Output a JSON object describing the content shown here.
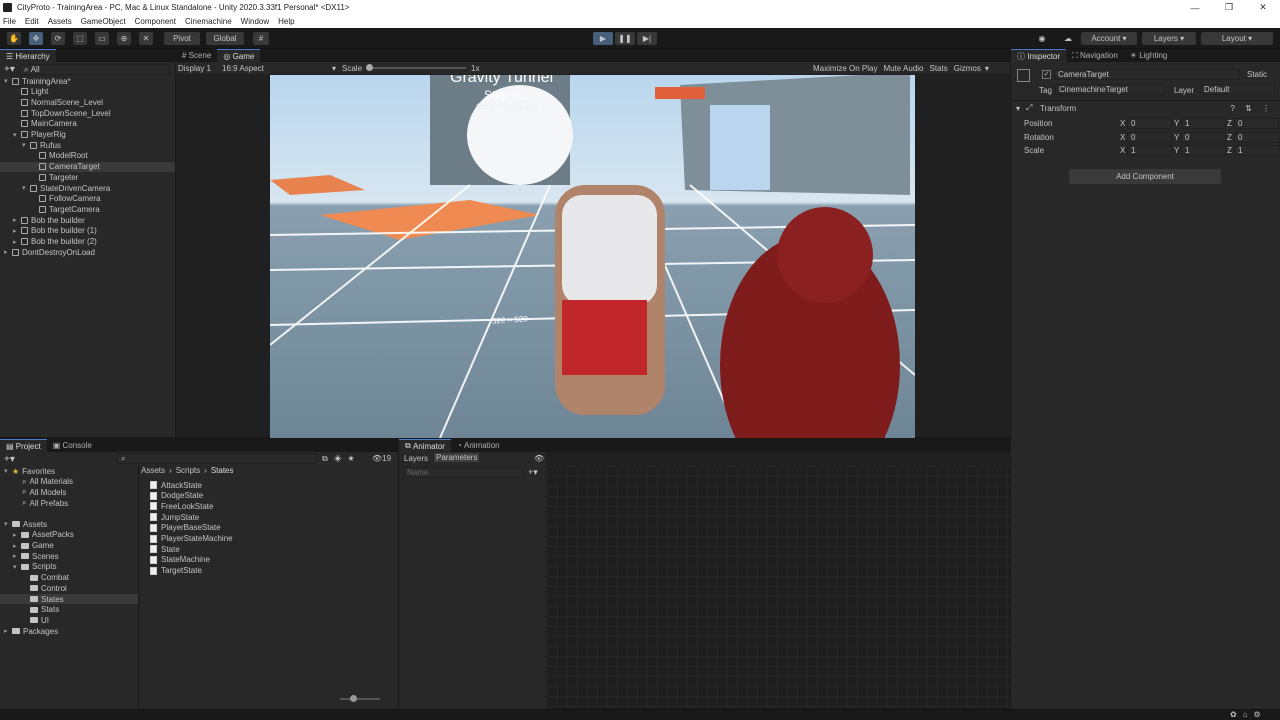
{
  "window": {
    "title": "CityProto - TrainingArea - PC, Mac & Linux Standalone - Unity 2020.3.33f1 Personal* <DX11>"
  },
  "menu": [
    "File",
    "Edit",
    "Assets",
    "GameObject",
    "Component",
    "Cinemachine",
    "Window",
    "Help"
  ],
  "toolbar": {
    "pivot": "Pivot",
    "global": "Global",
    "account": "Account",
    "layers": "Layers",
    "layout": "Layout"
  },
  "hierarchy": {
    "tab": "Hierarchy",
    "search_placeholder": "All",
    "items": [
      {
        "label": "TrainingArea*",
        "indent": 0,
        "expanded": true,
        "selected": false
      },
      {
        "label": "Light",
        "indent": 1
      },
      {
        "label": "NormalScene_Level",
        "indent": 1
      },
      {
        "label": "TopDownScene_Level",
        "indent": 1
      },
      {
        "label": "MainCamera",
        "indent": 1
      },
      {
        "label": "PlayerRig",
        "indent": 1,
        "expanded": true
      },
      {
        "label": "Rufus",
        "indent": 2,
        "expanded": true
      },
      {
        "label": "ModelRoot",
        "indent": 3
      },
      {
        "label": "CameraTarget",
        "indent": 3,
        "selected": true
      },
      {
        "label": "Targeter",
        "indent": 3
      },
      {
        "label": "StateDrivenCamera",
        "indent": 2,
        "expanded": true
      },
      {
        "label": "FollowCamera",
        "indent": 3
      },
      {
        "label": "TargetCamera",
        "indent": 3
      },
      {
        "label": "Bob the builder",
        "indent": 1,
        "collapsed": true
      },
      {
        "label": "Bob the builder (1)",
        "indent": 1,
        "collapsed": true
      },
      {
        "label": "Bob the builder (2)",
        "indent": 1,
        "collapsed": true
      },
      {
        "label": "DontDestroyOnLoad",
        "indent": 0,
        "collapsed": true
      }
    ]
  },
  "game": {
    "tabs": [
      "Scene",
      "Game"
    ],
    "display": "Display 1",
    "aspect": "16:9 Aspect",
    "scale_label": "Scale",
    "scale_value": "1x",
    "options": [
      "Maximize On Play",
      "Mute Audio",
      "Stats",
      "Gizmos"
    ],
    "overlay_title": "Gravity Tunnel",
    "overlay_step": "Step in...",
    "overlay_sub": "(but try not get sick)",
    "floor_label": "256 × 256"
  },
  "inspector": {
    "tabs": [
      "Inspector",
      "Navigation",
      "Lighting"
    ],
    "object_name": "CameraTarget",
    "static_label": "Static",
    "tag_label": "Tag",
    "tag_value": "CinemachineTarget",
    "layer_label": "Layer",
    "layer_value": "Default",
    "component": "Transform",
    "rows": [
      {
        "label": "Position",
        "x": "0",
        "y": "1",
        "z": "0"
      },
      {
        "label": "Rotation",
        "x": "0",
        "y": "0",
        "z": "0"
      },
      {
        "label": "Scale",
        "x": "1",
        "y": "1",
        "z": "1"
      }
    ],
    "add_component": "Add Component"
  },
  "project": {
    "tabs": [
      "Project",
      "Console"
    ],
    "hidden_count": "19",
    "favorites": {
      "label": "Favorites",
      "items": [
        "All Materials",
        "All Models",
        "All Prefabs"
      ]
    },
    "assets": {
      "label": "Assets",
      "items": [
        {
          "label": "AssetPacks",
          "indent": 1
        },
        {
          "label": "Game",
          "indent": 1
        },
        {
          "label": "Scenes",
          "indent": 1
        },
        {
          "label": "Scripts",
          "indent": 1
        },
        {
          "label": "Combat",
          "indent": 2
        },
        {
          "label": "Control",
          "indent": 2
        },
        {
          "label": "States",
          "indent": 2,
          "selected": true
        },
        {
          "label": "Stats",
          "indent": 2
        },
        {
          "label": "UI",
          "indent": 2
        }
      ]
    },
    "packages": "Packages",
    "breadcrumb": [
      "Assets",
      "Scripts",
      "States"
    ],
    "files": [
      "AttackState",
      "DodgeState",
      "FreeLookState",
      "JumpState",
      "PlayerBaseState",
      "PlayerStateMachine",
      "State",
      "StateMachine",
      "TargetState"
    ]
  },
  "animator": {
    "tabs": [
      "Animator",
      "Animation"
    ],
    "subtabs": [
      "Layers",
      "Parameters"
    ],
    "search_placeholder": "Name"
  },
  "colors": {
    "accent": "#4a7bd0",
    "selection": "#2c5d87",
    "panel": "#282828",
    "background": "#191919"
  }
}
